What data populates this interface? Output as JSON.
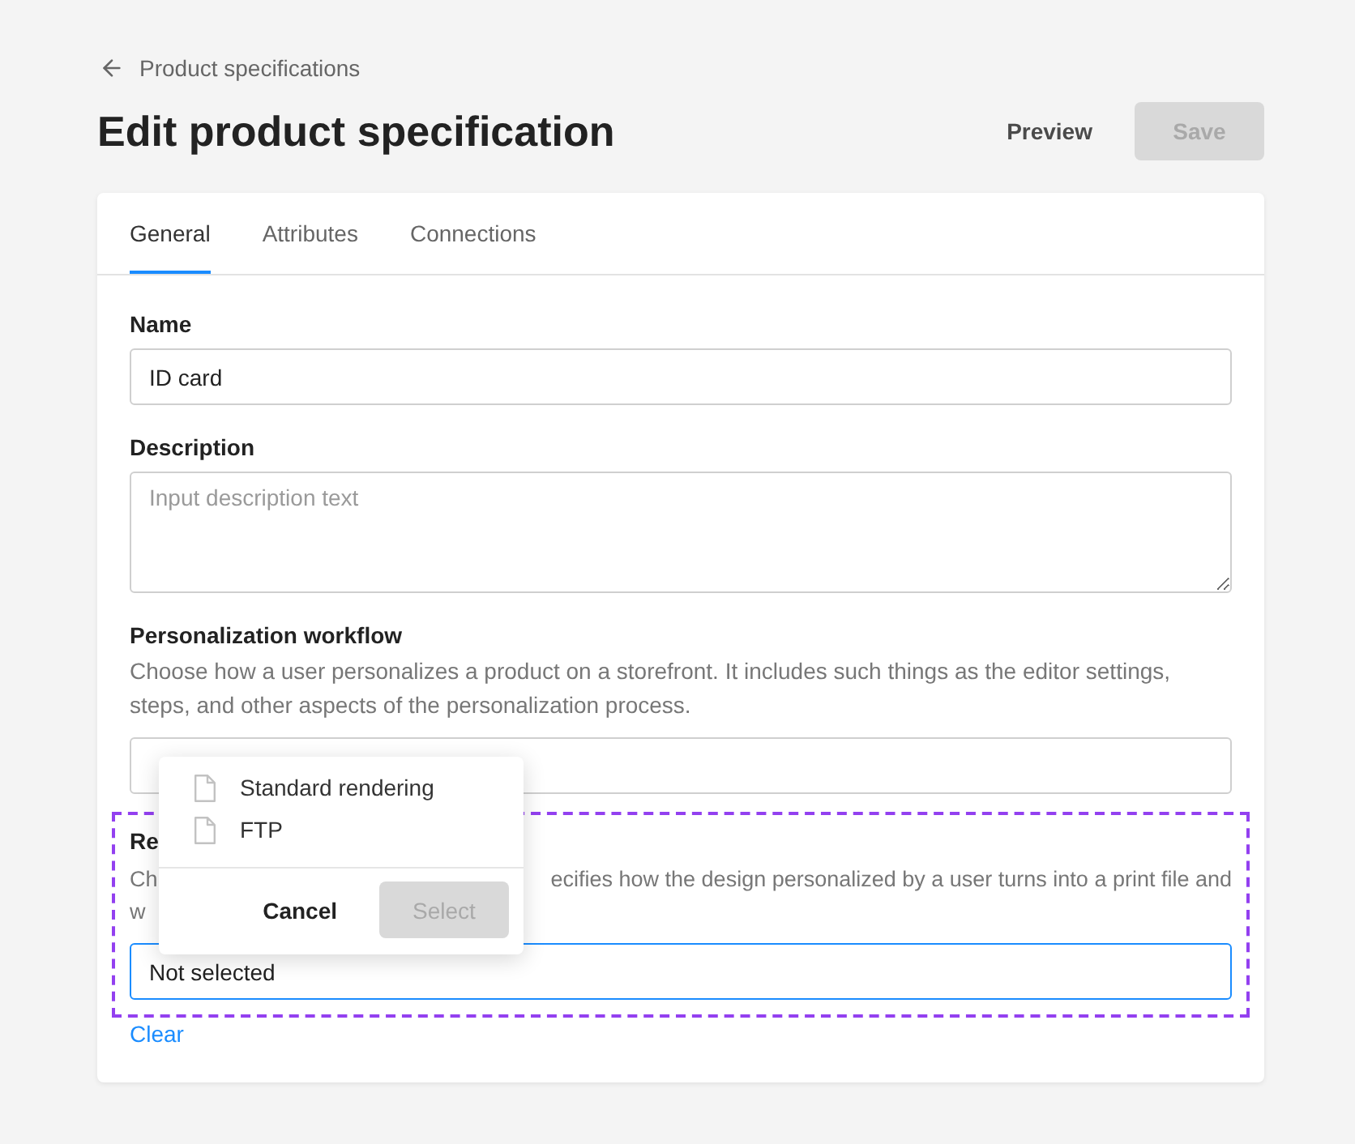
{
  "breadcrumb": {
    "label": "Product specifications"
  },
  "page_title": "Edit product specification",
  "header_buttons": [
    {
      "label": "Preview",
      "kind": "text",
      "disabled": false
    },
    {
      "label": "Save",
      "kind": "filled",
      "disabled": true
    }
  ],
  "tabs": [
    {
      "label": "General",
      "selected": true
    },
    {
      "label": "Attributes",
      "selected": false
    },
    {
      "label": "Connections",
      "selected": false
    }
  ],
  "form": {
    "name": {
      "label": "Name",
      "value": "ID card"
    },
    "description": {
      "label": "Description",
      "placeholder": "Input description text"
    },
    "personalization_workflow": {
      "label": "Personalization workflow",
      "help": "Choose how a user personalizes a product on a storefront. It includes such things as the editor settings, steps, and other aspects of the personalization process."
    },
    "rendering": {
      "label": "Re",
      "help_lines": [
        {
          "start": "Ch",
          "end": "ecifies how the design personalized by a user turns into a print file and"
        },
        {
          "start": "w"
        }
      ],
      "value": "Not selected",
      "focused": true,
      "highlighted": true,
      "clear_link": "Clear"
    }
  },
  "dropdown": {
    "items": [
      {
        "label": "Standard rendering",
        "selected": false
      },
      {
        "label": "FTP",
        "selected": false
      }
    ],
    "buttons": [
      {
        "label": "Cancel",
        "kind": "text",
        "disabled": false
      },
      {
        "label": "Select",
        "kind": "filled",
        "disabled": true
      }
    ]
  }
}
